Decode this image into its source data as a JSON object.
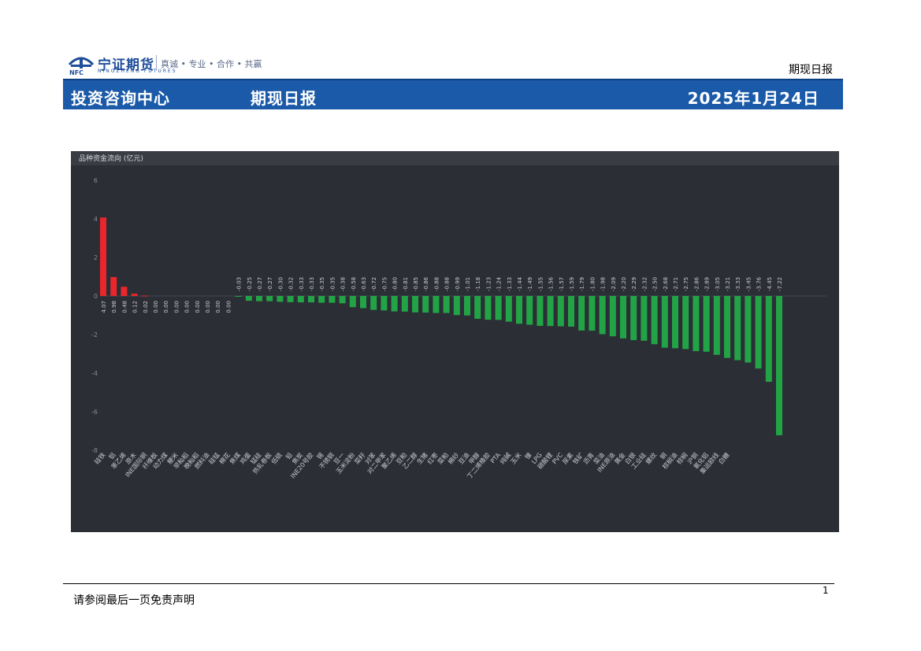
{
  "header": {
    "logo_name": "宁证期货",
    "logo_sub": "NINGZHENG FUTURES",
    "logo_abbr": "NFC",
    "slogan": "真诚 • 专业 • 合作 • 共赢",
    "top_right": "期现日报"
  },
  "banner": {
    "left": "投资咨询中心",
    "center": "期现日报",
    "date": "2025年1月24日"
  },
  "colors": {
    "banner": "#1b5aa8",
    "chart_bg": "#2c2e36",
    "positive": "#e8262b",
    "negative": "#22a446"
  },
  "chart_data": {
    "type": "bar",
    "title": "品种资金流向 (亿元)",
    "ylim": [
      -8,
      6
    ],
    "yticks": [
      -8,
      -6,
      -4,
      -2,
      0,
      2,
      4,
      6
    ],
    "categories": [
      "硅铁",
      "铝",
      "苯乙烯",
      "原木",
      "INE国际铜",
      "纤维板",
      "动力煤",
      "粳米",
      "早籼稻",
      "晚籼稻",
      "燃料油",
      "硅锰",
      "棉花",
      "焦煤",
      "鸡蛋",
      "锰硅",
      "热轧卷板",
      "低硫",
      "铅",
      "焦炭",
      "INE20号胶",
      "锡",
      "不锈钢",
      "豆一",
      "玉米淀粉",
      "菜籽",
      "对苯",
      "对二甲苯",
      "聚乙烯",
      "豆粕",
      "乙二醇",
      "生猪",
      "红枣",
      "菜粕",
      "棉纱",
      "豆油",
      "甲醇",
      "丁二烯橡胶",
      "PTA",
      "纯碱",
      "玉米",
      "镍",
      "LPG",
      "碳酸锂",
      "PVC",
      "尿素",
      "铁矿",
      "沥青",
      "菜油",
      "INE原油",
      "黄金",
      "白银",
      "工业硅",
      "螺纹",
      "铜",
      "棕榈油",
      "棕榈",
      "沪铜",
      "氧化铝",
      "集运欧线",
      "白糖"
    ],
    "values": [
      4.07,
      0.98,
      0.48,
      0.12,
      0.02,
      0.0,
      0.0,
      0.0,
      0.0,
      0.0,
      0.0,
      0.0,
      0.0,
      -0.03,
      -0.25,
      -0.27,
      -0.27,
      -0.3,
      -0.32,
      -0.33,
      -0.33,
      -0.35,
      -0.35,
      -0.38,
      -0.58,
      -0.63,
      -0.72,
      -0.75,
      -0.8,
      -0.81,
      -0.85,
      -0.86,
      -0.88,
      -0.88,
      -0.99,
      -1.01,
      -1.18,
      -1.23,
      -1.24,
      -1.33,
      -1.44,
      -1.49,
      -1.55,
      -1.56,
      -1.57,
      -1.59,
      -1.79,
      -1.8,
      -1.98,
      -2.09,
      -2.2,
      -2.29,
      -2.32,
      -2.5,
      -2.68,
      -2.71,
      -2.75,
      -2.86,
      -2.89,
      -3.05,
      -3.21,
      -3.33,
      -3.45,
      -3.76,
      -4.45,
      -7.22
    ],
    "value_labels": [
      "4.07",
      "0.98",
      "0.48",
      "0.12",
      "0.02",
      "0.00",
      "0.00",
      "0.00",
      "0.00",
      "0.00",
      "0.00",
      "0.00",
      "0.00",
      "-0.03",
      "-0.25",
      "-0.27",
      "-0.27",
      "-0.30",
      "-0.32",
      "-0.33",
      "-0.33",
      "-0.35",
      "-0.35",
      "-0.38",
      "-0.58",
      "-0.63",
      "-0.72",
      "-0.75",
      "-0.80",
      "-0.81",
      "-0.85",
      "-0.86",
      "-0.88",
      "-0.88",
      "-0.99",
      "-1.01",
      "-1.18",
      "-1.23",
      "-1.24",
      "-1.33",
      "-1.44",
      "-1.49",
      "-1.55",
      "-1.56",
      "-1.57",
      "-1.59",
      "-1.79",
      "-1.80",
      "-1.98",
      "-2.09",
      "-2.20",
      "-2.29",
      "-2.32",
      "-2.50",
      "-2.68",
      "-2.71",
      "-2.75",
      "-2.86",
      "-2.89",
      "-3.05",
      "-3.21",
      "-3.33",
      "-3.45",
      "-3.76",
      "-4.45",
      "-7.22"
    ],
    "legend": "none",
    "grid": false
  },
  "footer": {
    "disclaimer": "请参阅最后一页免责声明",
    "page_number": "1"
  }
}
